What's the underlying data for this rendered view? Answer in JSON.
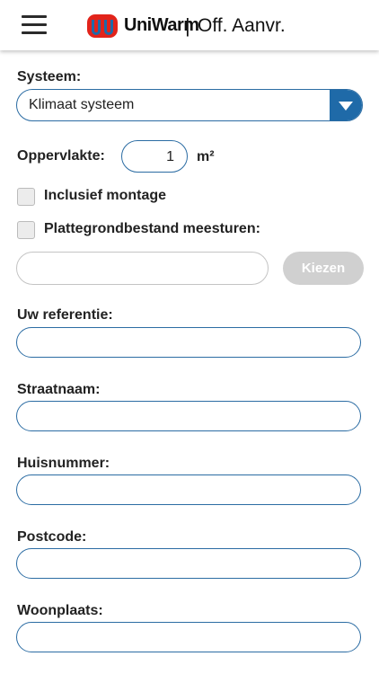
{
  "header": {
    "brand": "UniWarm",
    "separator": "|",
    "title": "Off. Aanvr."
  },
  "form": {
    "system_label": "Systeem:",
    "system_value": "Klimaat systeem",
    "area_label": "Oppervlakte:",
    "area_value": "1",
    "area_unit": "m²",
    "include_installation_label": "Inclusief montage",
    "include_installation_checked": false,
    "attach_floorplan_label": "Plattegrondbestand meesturen:",
    "attach_floorplan_checked": false,
    "file_value": "",
    "choose_button": "Kiezen",
    "reference_label": "Uw referentie:",
    "reference_value": "",
    "street_label": "Straatnaam:",
    "street_value": "",
    "house_number_label": "Huisnummer:",
    "house_number_value": "",
    "postcode_label": "Postcode:",
    "postcode_value": "",
    "city_label": "Woonplaats:",
    "city_value": ""
  },
  "colors": {
    "accent": "#1f6aa8",
    "field_border": "#2b6ca3",
    "logo_red": "#e2231a",
    "logo_blue": "#1f6aa8",
    "button_disabled": "#d0d0d0"
  }
}
